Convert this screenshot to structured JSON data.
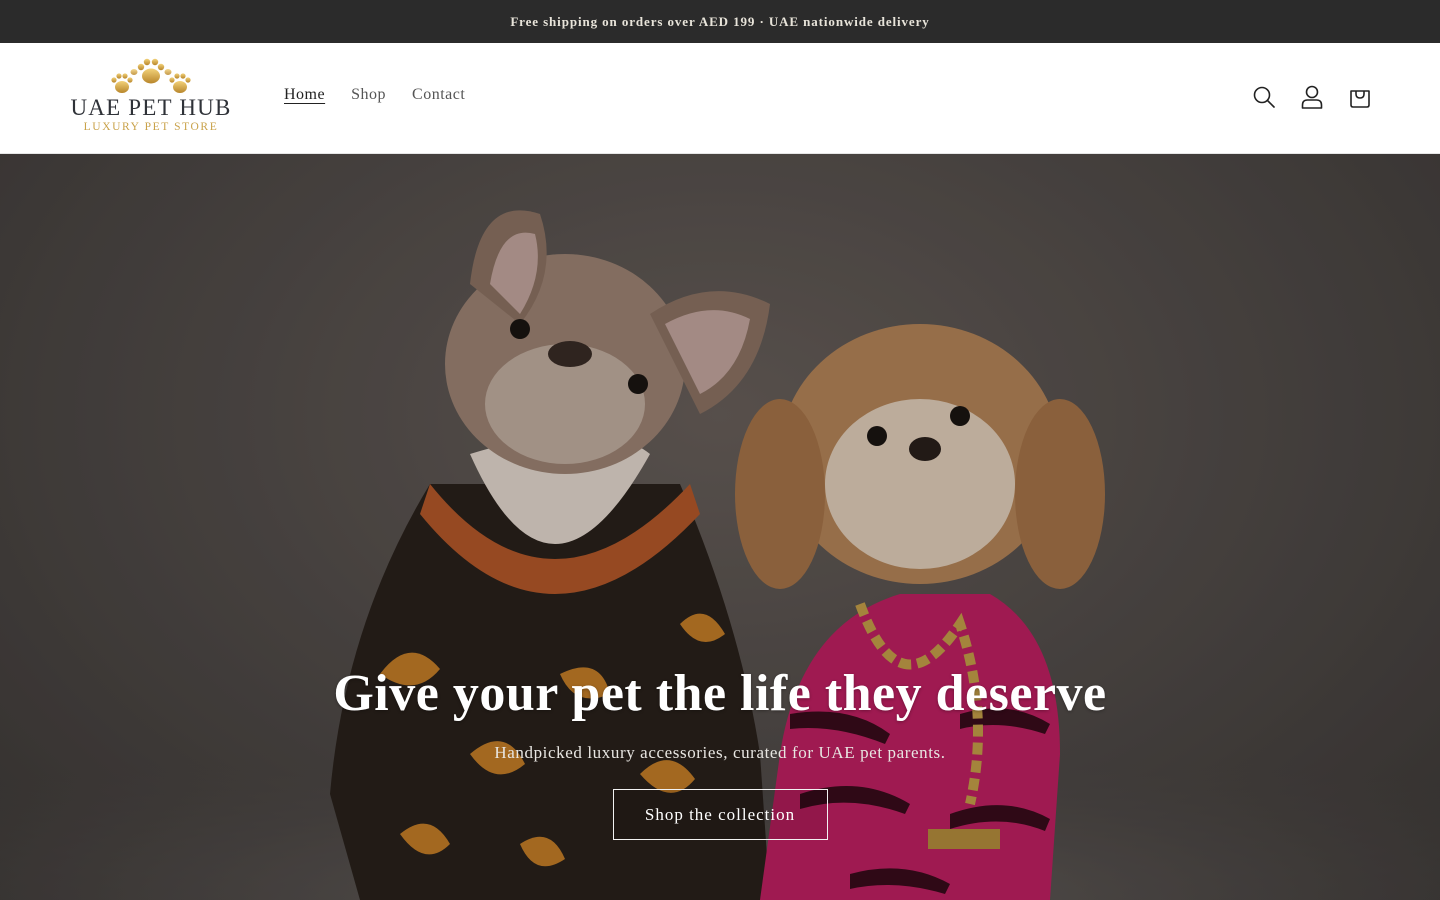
{
  "announcement": {
    "text": "Free shipping on orders over AED 199 · UAE nationwide delivery"
  },
  "brand": {
    "name": "UAE PET HUB",
    "tagline": "LUXURY PET STORE",
    "accent_color": "#c9a24a"
  },
  "nav": {
    "items": [
      {
        "label": "Home",
        "active": true
      },
      {
        "label": "Shop",
        "active": false
      },
      {
        "label": "Contact",
        "active": false
      }
    ]
  },
  "header_icons": [
    "search-icon",
    "account-icon",
    "cart-icon"
  ],
  "hero": {
    "title": "Give your pet the life they deserve",
    "subtitle": "Handpicked luxury accessories, curated for UAE pet parents.",
    "cta_label": "Shop the collection"
  }
}
